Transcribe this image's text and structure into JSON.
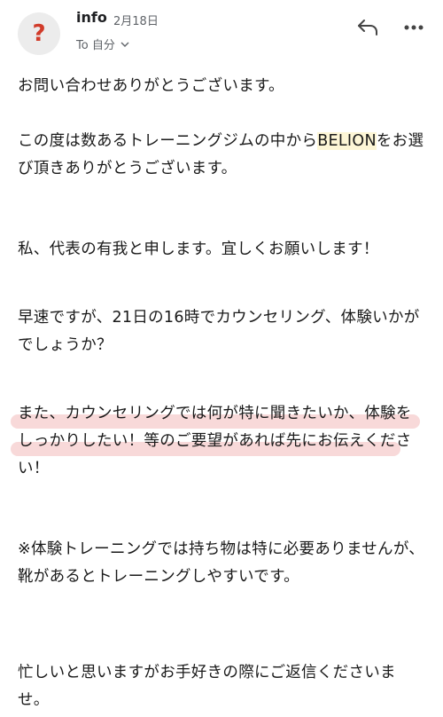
{
  "header": {
    "sender": "info",
    "date": "2月18日",
    "to_label": "To 自分",
    "avatar_glyph": "?",
    "avatar_color": "#d13b2a"
  },
  "body": {
    "p1": "お問い合わせありがとうございます。",
    "p2_pre": "この度は数あるトレーニングジムの中から",
    "p2_brand": "BELION",
    "p2_post": "をお選び頂きありがとうございます。",
    "p3": "私、代表の有我と申します。宜しくお願いします！",
    "p4": "早速ですが、21日の16時でカウンセリング、体験いかがでしょうか？",
    "p5": "また、カウンセリングでは何が特に聞きたいか、体験をしっかりしたい！等のご要望があれば先にお伝えください！",
    "p6": "※体験トレーニングでは持ち物は特に必要ありませんが、靴があるとトレーニングしやすいです。",
    "p7": "忙しいと思いますがお手好きの際にご返信くださいませ。"
  },
  "colors": {
    "brand_highlight": "#fdf6d6",
    "pink_marker": "#f0aaaa"
  }
}
